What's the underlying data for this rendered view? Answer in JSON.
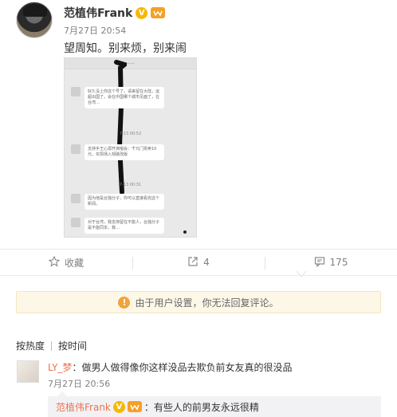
{
  "post": {
    "author": "范植伟Frank",
    "verified_badge": "V",
    "time": "7月27日 20:54",
    "text": "望周知。别来烦，别来闹"
  },
  "screenshot": {
    "topbar_text": "——",
    "messages": [
      {
        "text": "好久没上你这个号了，请来留在大陆，运超出国了，会在中国哪个城市见面了，在台湾…"
      },
      {
        "text": "支持手王心源开演唱会：千元门票卖10元，买现场入观破改版"
      },
      {
        "text": "因为他是台独分子，你可以直接看完这个新闻。"
      },
      {
        "text": "对于台湾，我支持留在不能人，台独分子是不能同本，我…"
      }
    ],
    "times": [
      "7-13 00:52",
      "7-13 00:31"
    ]
  },
  "actions": {
    "collect_label": "收藏",
    "forward_count": "4",
    "comment_count": "175"
  },
  "notice": {
    "text": "由于用户设置，你无法回复评论。"
  },
  "sort": {
    "hot": "按热度",
    "time": "按时间"
  },
  "comment": {
    "user": "LY_梦",
    "text": "：做男人做得像你这样没品去欺负前女友真的很没品",
    "time": "7月27日 20:56"
  },
  "reply": {
    "user": "范植伟Frank",
    "verified_badge": "V",
    "text": "：有些人的前男友永远很精"
  },
  "colors": {
    "link": "#eb7350",
    "notice_bg": "#fdf7e7",
    "warn": "#f2a23c",
    "verified": "#f6b800"
  }
}
